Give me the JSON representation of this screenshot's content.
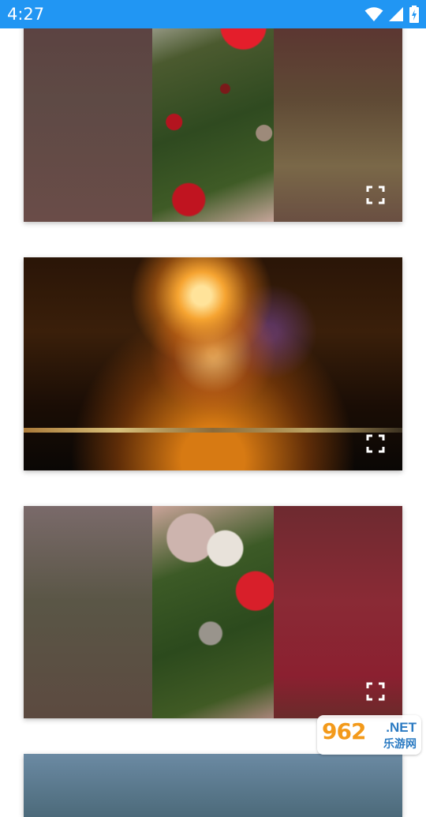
{
  "status_bar": {
    "time": "4:27",
    "icons": [
      "wifi-icon",
      "signal-icon",
      "battery-icon"
    ],
    "background": "#2196f3"
  },
  "feed": {
    "items": [
      {
        "scene": "christmas-tree-red-bow",
        "action_icon": "fullscreen-icon"
      },
      {
        "scene": "fireworks-over-water",
        "action_icon": "fullscreen-icon"
      },
      {
        "scene": "christmas-tree-angel-ornament",
        "action_icon": "fullscreen-icon"
      },
      {
        "scene": "partial-landscape",
        "action_icon": ""
      }
    ]
  },
  "watermark": {
    "number": "962",
    "suffix": ".NET",
    "text_cn": "乐游网",
    "colors": {
      "number": "#f39a1b",
      "text": "#2a7ac2"
    }
  }
}
